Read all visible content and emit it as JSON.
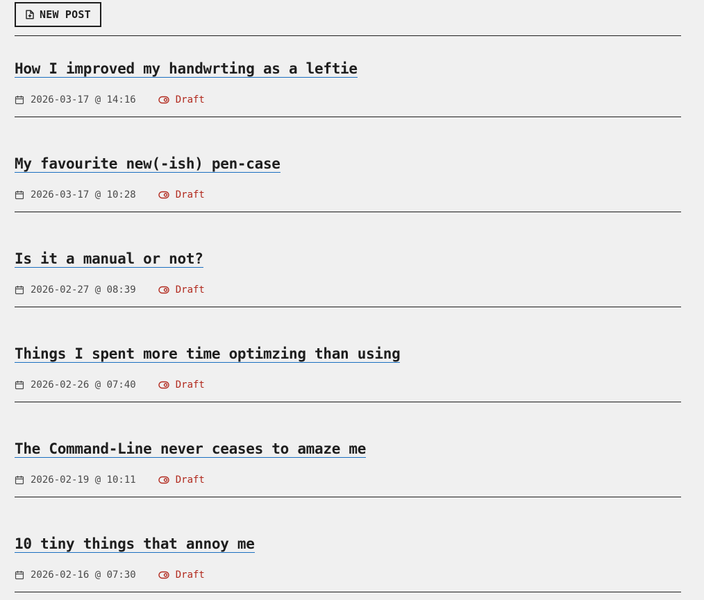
{
  "toolbar": {
    "new_post_label": "NEW POST",
    "new_post_icon": "file-plus-icon"
  },
  "colors": {
    "background": "#f0f0f0",
    "text": "#1e1e1e",
    "link_underline": "#1a6fc0",
    "draft_status": "#b22a1e"
  },
  "posts": [
    {
      "title": "How I improved my handwrting as a leftie",
      "datetime": "2026-03-17 @ 14:16",
      "status": "Draft"
    },
    {
      "title": "My favourite new(-ish) pen-case",
      "datetime": "2026-03-17 @ 10:28",
      "status": "Draft"
    },
    {
      "title": "Is it a manual or not?",
      "datetime": "2026-02-27 @ 08:39",
      "status": "Draft"
    },
    {
      "title": "Things I spent more time optimzing than using",
      "datetime": "2026-02-26 @ 07:40",
      "status": "Draft"
    },
    {
      "title": "The Command-Line never ceases to amaze me",
      "datetime": "2026-02-19 @ 10:11",
      "status": "Draft"
    },
    {
      "title": "10 tiny things that annoy me",
      "datetime": "2026-02-16 @ 07:30",
      "status": "Draft"
    }
  ]
}
